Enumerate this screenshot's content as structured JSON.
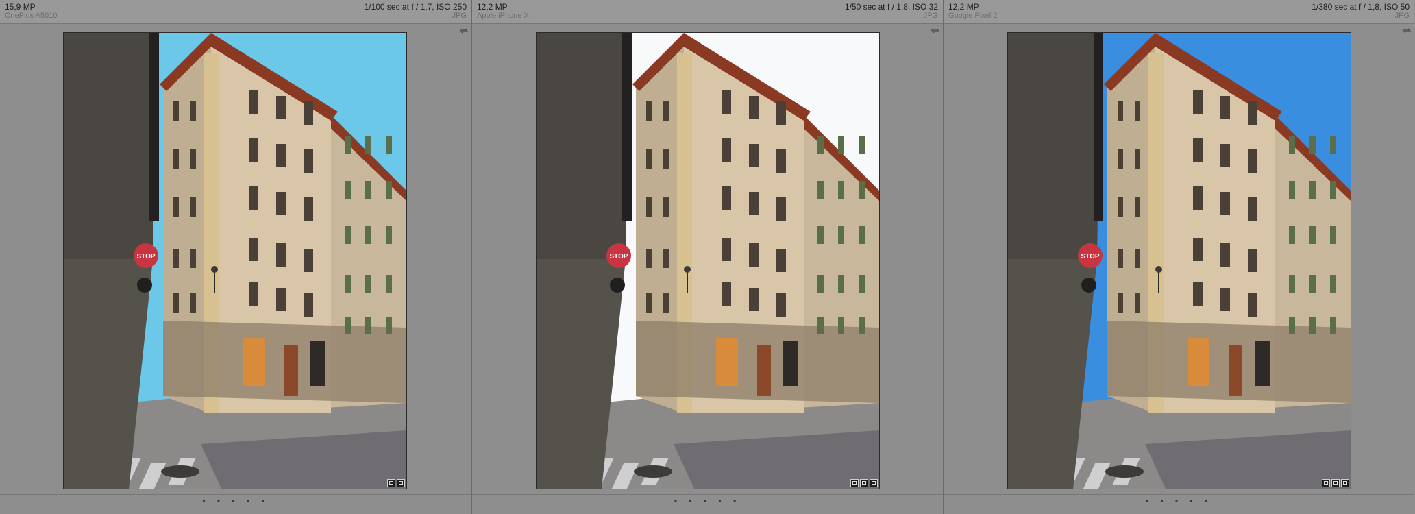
{
  "panels": [
    {
      "megapixels": "15,9 MP",
      "camera": "OnePlus A5010",
      "exposure": "1/100 sec at f / 1,7, ISO 250",
      "format": "JPG",
      "sky_color": "#6cc8e8",
      "rating_dots": "• • • • •",
      "badge_count": 2
    },
    {
      "megapixels": "12,2 MP",
      "camera": "Apple iPhone X",
      "exposure": "1/50 sec at f / 1,8, ISO 32",
      "format": "JPG",
      "sky_color": "#f7f9fb",
      "rating_dots": "• • • • •",
      "badge_count": 3
    },
    {
      "megapixels": "12,2 MP",
      "camera": "Google Pixel 2",
      "exposure": "1/380 sec at f / 1,8, ISO 50",
      "format": "JPG",
      "sky_color": "#3a8ee0",
      "rating_dots": "• • • • •",
      "badge_count": 3
    }
  ],
  "photo_content": {
    "sign_text": "STOP"
  },
  "icons": {
    "flip": "flip-arrows-icon",
    "badges": [
      "comment-badge-icon",
      "collection-badge-icon",
      "edited-badge-icon"
    ]
  },
  "colors": {
    "background": "#8f8f8f",
    "header": "#999999",
    "wall": "#4a4642",
    "facade": "#d9c6a8",
    "roof": "#8a3a22",
    "street": "#8c8a88"
  }
}
